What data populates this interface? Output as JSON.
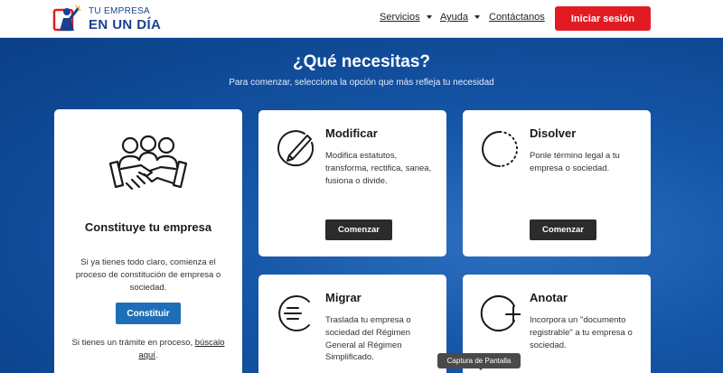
{
  "header": {
    "logo_top": "TU EMPRESA",
    "logo_bottom": "EN UN DÍA",
    "nav": [
      {
        "label": "Servicios",
        "dropdown": true
      },
      {
        "label": "Ayuda",
        "dropdown": true
      },
      {
        "label": "Contáctanos",
        "dropdown": false
      }
    ],
    "login_label": "Iniciar sesión"
  },
  "hero": {
    "title": "¿Qué necesitas?",
    "subtitle": "Para comenzar, selecciona la opción que más refleja tu necesidad"
  },
  "cards": {
    "constituye": {
      "title": "Constituye tu empresa",
      "description": "Si ya tienes todo claro, comienza el proceso de constitución de empresa o sociedad.",
      "button": "Constituir",
      "footer_text": "Si tienes un trámite en proceso,",
      "footer_link": "búscalo aquí",
      "footer_end": "."
    },
    "modificar": {
      "title": "Modificar",
      "description": "Modifica estatutos, transforma, rectifica, sanea, fusiona o divide.",
      "button": "Comenzar"
    },
    "disolver": {
      "title": "Disolver",
      "description": "Ponle término legal a tu empresa o sociedad.",
      "button": "Comenzar"
    },
    "migrar": {
      "title": "Migrar",
      "description": "Traslada tu empresa o sociedad del Régimen General al Régimen Simplificado."
    },
    "anotar": {
      "title": "Anotar",
      "description": "Incorpora un \"documento registrable\" a tu empresa o sociedad."
    }
  },
  "tooltip": "Captura de Pantalla",
  "colors": {
    "brand_blue": "#1b3f8f",
    "login_red": "#e21b23",
    "hero_blue": "#1556a8",
    "button_blue": "#1e6fb8",
    "button_dark": "#2b2b2b"
  },
  "icons": [
    "logo-icon",
    "handshake-team-icon",
    "pencil-circle-icon",
    "dotted-circle-icon",
    "exit-arrow-icon",
    "plus-circle-icon"
  ]
}
